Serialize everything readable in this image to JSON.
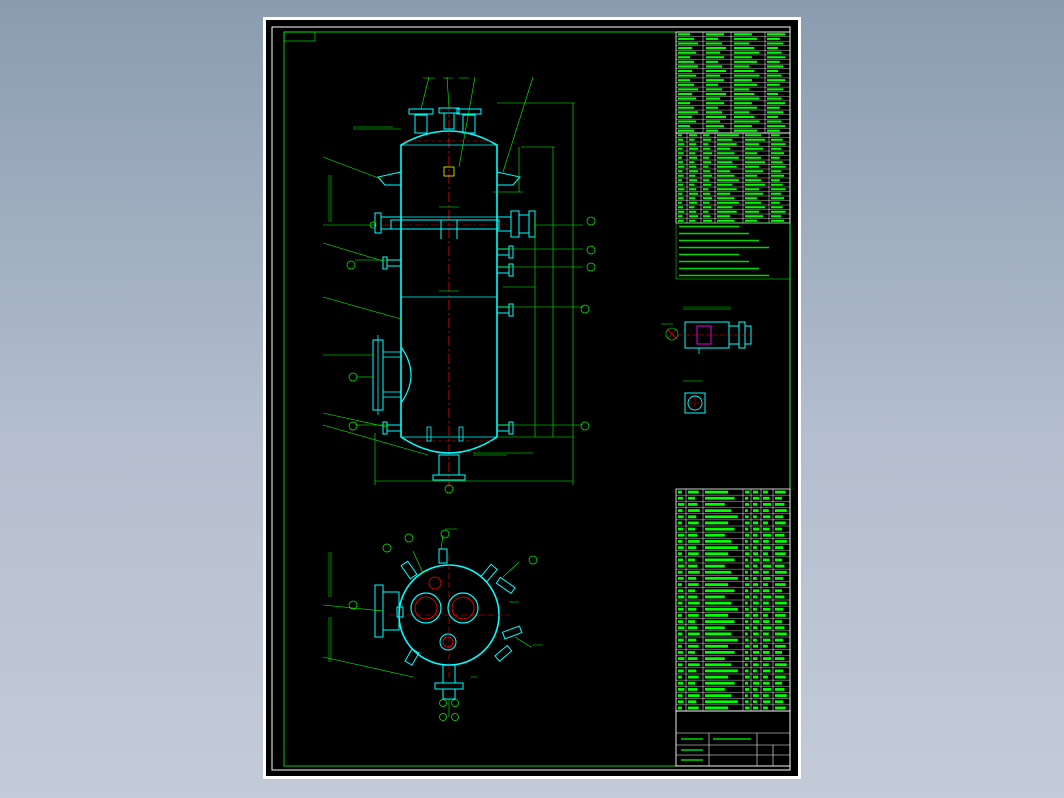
{
  "viewer": {
    "background": "#9aa8ba"
  },
  "drawing": {
    "background": "#000000",
    "colors": {
      "frame": "#ffffff",
      "vessel": "#00ffff",
      "dimension": "#00ff00",
      "centerline": "#ff0000",
      "hidden": "#ff00ff",
      "yellow": "#ffff00"
    },
    "views": [
      "front-elevation",
      "top-plan",
      "nozzle-detail",
      "small-detail"
    ],
    "callouts": [
      {
        "view": "front",
        "id": "a1"
      },
      {
        "view": "front",
        "id": "a2"
      },
      {
        "view": "front",
        "id": "a3"
      },
      {
        "view": "front",
        "id": "a4"
      },
      {
        "view": "front",
        "id": "a5"
      },
      {
        "view": "front",
        "id": "a6"
      },
      {
        "view": "front",
        "id": "a7"
      },
      {
        "view": "front",
        "id": "a8"
      },
      {
        "view": "top",
        "id": "b1"
      },
      {
        "view": "top",
        "id": "b2"
      },
      {
        "view": "top",
        "id": "b3"
      },
      {
        "view": "top",
        "id": "b4"
      },
      {
        "view": "top",
        "id": "b5"
      },
      {
        "view": "top",
        "id": "b6"
      }
    ],
    "tables": {
      "design_data_rows": 22,
      "nozzle_table_rows": 20,
      "notes_rows": 8,
      "parts_list_rows": 36,
      "title_block_rows": 4
    }
  }
}
